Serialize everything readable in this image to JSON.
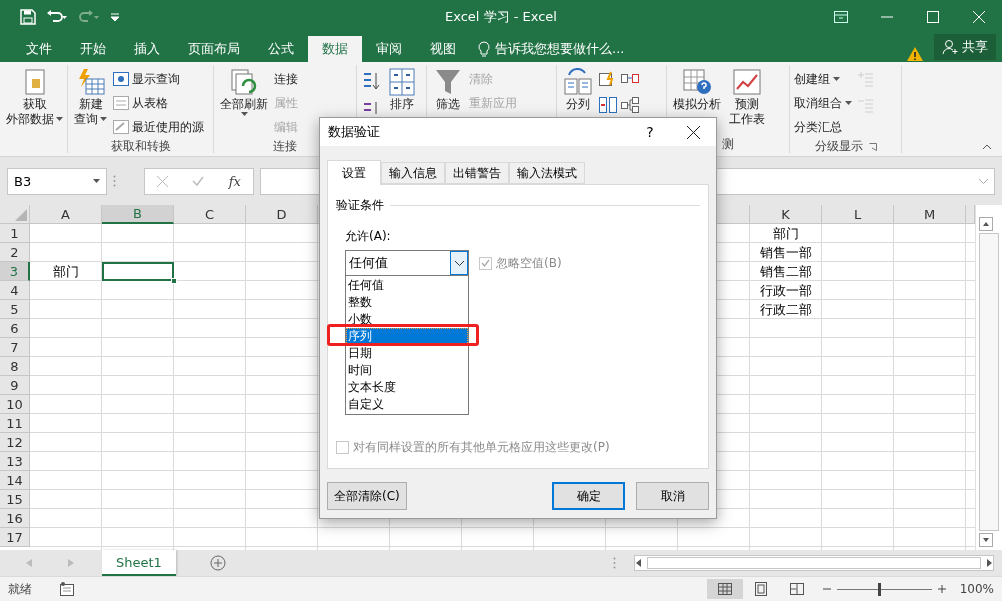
{
  "window": {
    "title": "Excel 学习 - Excel"
  },
  "ribbon_tabs": [
    {
      "label": "文件",
      "selected": false
    },
    {
      "label": "开始",
      "selected": false
    },
    {
      "label": "插入",
      "selected": false
    },
    {
      "label": "页面布局",
      "selected": false
    },
    {
      "label": "公式",
      "selected": false
    },
    {
      "label": "数据",
      "selected": true
    },
    {
      "label": "审阅",
      "selected": false
    },
    {
      "label": "视图",
      "selected": false
    }
  ],
  "tell_me": {
    "placeholder": "告诉我您想要做什么..."
  },
  "share_button": "共享",
  "ribbon_groups": [
    {
      "commands": [
        {
          "kind": "large",
          "lines": [
            "获取",
            "外部数据"
          ],
          "dropdown": true,
          "disabled": false
        }
      ]
    },
    {
      "label": "获取和转换",
      "commands": [
        {
          "kind": "large",
          "lines": [
            "新建",
            "查询"
          ],
          "dropdown": true,
          "disabled": false
        },
        {
          "kind": "stack",
          "items": [
            {
              "label": "显示查询",
              "dropdown": false,
              "disabled": false
            },
            {
              "label": "从表格",
              "dropdown": false,
              "disabled": false
            },
            {
              "label": "最近使用的源",
              "dropdown": false,
              "disabled": false
            }
          ]
        }
      ]
    },
    {
      "label": "连接",
      "commands": [
        {
          "kind": "large",
          "lines": [
            "全部刷新"
          ],
          "dropdown": true,
          "disabled": false
        },
        {
          "kind": "stack",
          "items": [
            {
              "label": "连接",
              "dropdown": false,
              "disabled": false
            },
            {
              "label": "属性",
              "dropdown": false,
              "disabled": true
            },
            {
              "label": "编辑",
              "dropdown": false,
              "disabled": true
            }
          ]
        }
      ]
    },
    {
      "commands": [
        {
          "kind": "icons",
          "items": [
            {
              "disabled": false
            },
            {
              "disabled": false
            }
          ]
        },
        {
          "kind": "large",
          "lines": [
            "排序"
          ],
          "dropdown": false,
          "disabled": false
        }
      ]
    },
    {
      "commands": [
        {
          "kind": "large",
          "lines": [
            "筛选"
          ],
          "dropdown": false,
          "disabled": false
        },
        {
          "kind": "stack",
          "items": [
            {
              "label": "清除",
              "dropdown": false,
              "disabled": true
            },
            {
              "label": "重新应用",
              "dropdown": false,
              "disabled": true
            }
          ]
        }
      ]
    },
    {
      "commands": [
        {
          "kind": "large",
          "lines": [
            "分列"
          ],
          "dropdown": false,
          "disabled": false
        },
        {
          "kind": "icons",
          "items": [
            {
              "disabled": false
            },
            {
              "disabled": false
            }
          ]
        },
        {
          "kind": "icons",
          "items": [
            {
              "disabled": false
            },
            {
              "disabled": false
            }
          ]
        }
      ]
    },
    {
      "label": "测",
      "commands": [
        {
          "kind": "large",
          "lines": [
            "模拟分析"
          ],
          "dropdown": false,
          "disabled": false
        },
        {
          "kind": "large",
          "lines": [
            "预测",
            "工作表"
          ],
          "dropdown": false,
          "disabled": false
        }
      ]
    },
    {
      "label": "分级显示",
      "launcher": true,
      "commands": [
        {
          "kind": "stack",
          "items": [
            {
              "label": "创建组",
              "dropdown": true,
              "disabled": false
            },
            {
              "label": "取消组合",
              "dropdown": true,
              "disabled": false
            },
            {
              "label": "分类汇总",
              "dropdown": false,
              "disabled": false
            }
          ]
        },
        {
          "kind": "icons",
          "items": [
            {
              "disabled": true
            },
            {
              "disabled": true
            }
          ]
        }
      ]
    }
  ],
  "formula_bar": {
    "name_box": "B3",
    "function_label": "fx"
  },
  "columns_left": [
    {
      "label": "A",
      "selected": false
    },
    {
      "label": "B",
      "selected": true
    },
    {
      "label": "C",
      "selected": false
    },
    {
      "label": "D",
      "selected": false
    }
  ],
  "columns_right": [
    {
      "label": "K",
      "selected": false
    },
    {
      "label": "L",
      "selected": false
    },
    {
      "label": "M",
      "selected": false
    }
  ],
  "rows": [
    {
      "header": "1",
      "selected": false,
      "cells_right": [
        {
          "text": "部门",
          "selected": false
        }
      ]
    },
    {
      "header": "2",
      "selected": false,
      "cells_right": [
        {
          "text": "销售一部",
          "selected": false
        }
      ]
    },
    {
      "header": "3",
      "selected": true,
      "cells_left": [
        {
          "text": "部门",
          "selected": false
        },
        {
          "selected": true
        }
      ],
      "cells_right": [
        {
          "text": "销售二部",
          "selected": false
        }
      ]
    },
    {
      "header": "4",
      "selected": false,
      "cells_right": [
        {
          "text": "行政一部",
          "selected": false
        }
      ]
    },
    {
      "header": "5",
      "selected": false,
      "cells_right": [
        {
          "text": "行政二部",
          "selected": false
        }
      ]
    },
    {
      "header": "6",
      "selected": false
    },
    {
      "header": "7",
      "selected": false
    },
    {
      "header": "8",
      "selected": false
    },
    {
      "header": "9",
      "selected": false
    },
    {
      "header": "10",
      "selected": false
    },
    {
      "header": "11",
      "selected": false
    },
    {
      "header": "12",
      "selected": false
    },
    {
      "header": "13",
      "selected": false
    },
    {
      "header": "14",
      "selected": false
    },
    {
      "header": "15",
      "selected": false
    },
    {
      "header": "16",
      "selected": false
    },
    {
      "header": "17",
      "selected": false
    }
  ],
  "sheet_tabs": [
    {
      "label": "Sheet1",
      "selected": true
    }
  ],
  "status_bar": {
    "status": "就绪",
    "zoom": "100%",
    "zoom_slider": {
      "level": 0.45
    }
  },
  "dialog": {
    "title": "数据验证",
    "help": "?",
    "tabs": [
      {
        "label": "设置",
        "selected": true
      },
      {
        "label": "输入信息",
        "selected": false
      },
      {
        "label": "出错警告",
        "selected": false
      },
      {
        "label": "输入法模式",
        "selected": false
      }
    ],
    "section": "验证条件",
    "allow_label": "允许(A):",
    "allow_value": "任何值",
    "options": [
      {
        "label": "任何值",
        "selected": false
      },
      {
        "label": "整数",
        "selected": false
      },
      {
        "label": "小数",
        "selected": false
      },
      {
        "label": "序列",
        "selected": true
      },
      {
        "label": "日期",
        "selected": false
      },
      {
        "label": "时间",
        "selected": false
      },
      {
        "label": "文本长度",
        "selected": false
      },
      {
        "label": "自定义",
        "selected": false
      }
    ],
    "ignore_blank": {
      "label": "忽略空值(B)",
      "checked": true,
      "disabled": true
    },
    "apply_all": {
      "label": "对有同样设置的所有其他单元格应用这些更改(P)",
      "checked": false,
      "disabled": true
    },
    "buttons": [
      {
        "label": "全部清除(C)",
        "kind": "plain"
      },
      {
        "label": "确定",
        "kind": "default"
      },
      {
        "label": "取消",
        "kind": "plain"
      }
    ]
  }
}
